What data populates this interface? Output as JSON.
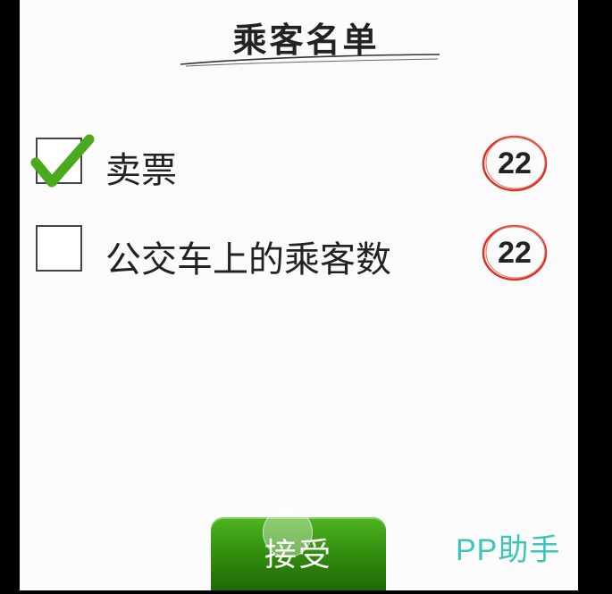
{
  "title": "乘客名单",
  "rows": [
    {
      "label": "卖票",
      "checked": true,
      "count": "22"
    },
    {
      "label": "公交车上的乘客数",
      "checked": false,
      "count": "22"
    }
  ],
  "accept_button": {
    "label": "接受"
  },
  "watermark": "PP助手",
  "colors": {
    "check_green": "#4aa91c",
    "badge_red": "#d9342b",
    "button_green": "#2f8a0d",
    "watermark_teal": "#3cc6b8"
  },
  "icons": [
    "checkmark-icon",
    "checkbox-icon",
    "count-badge-circle"
  ]
}
